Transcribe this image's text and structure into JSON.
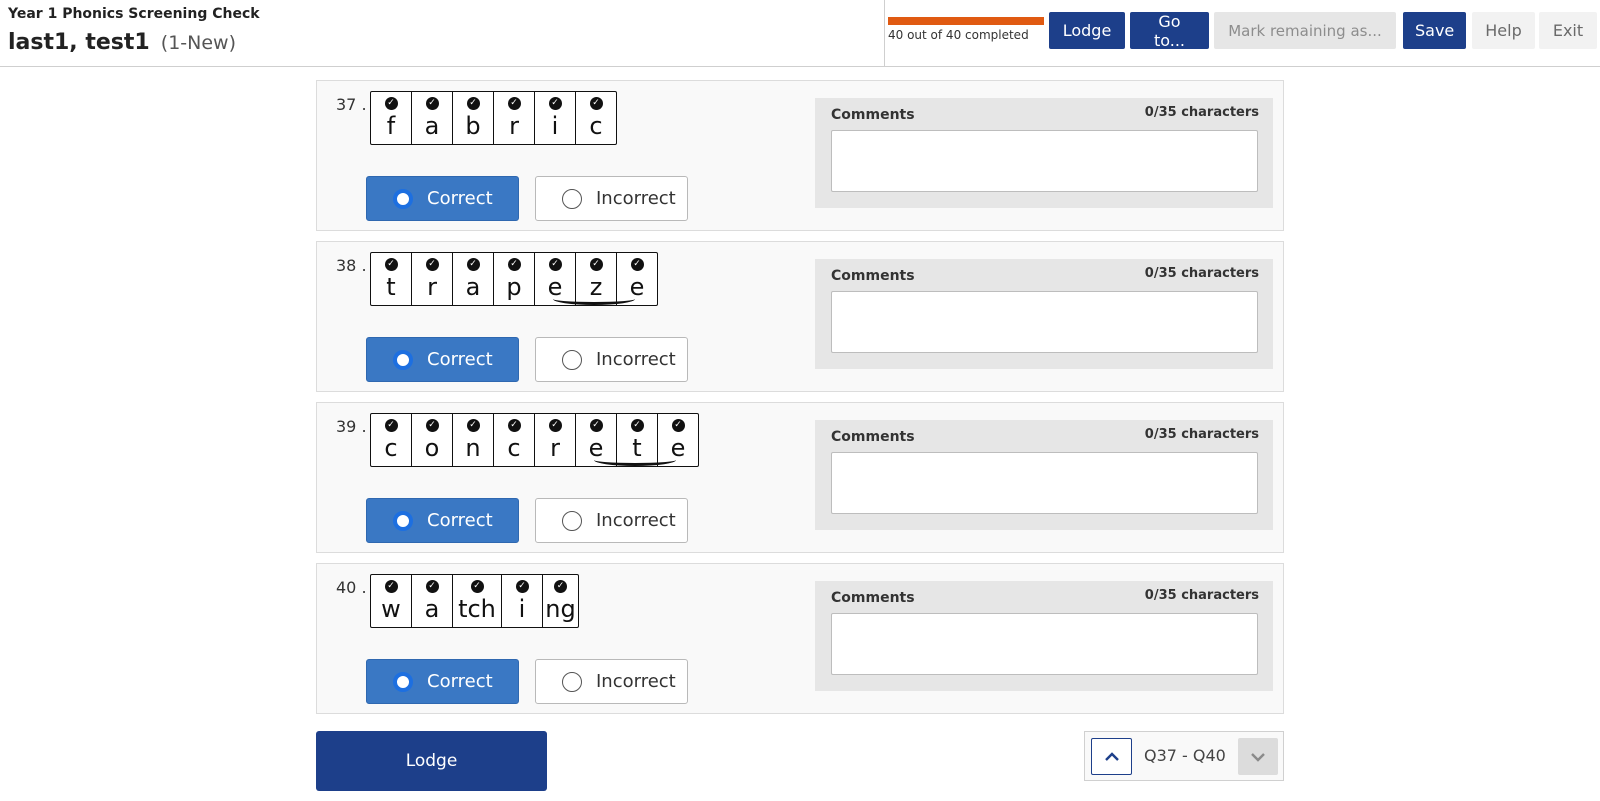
{
  "header": {
    "app_title": "Year 1 Phonics Screening Check",
    "student_name": "last1, test1",
    "student_meta": "(1-New)",
    "progress": {
      "completed": 40,
      "total": 40,
      "fraction": 1.0,
      "text": "40 out of 40 completed",
      "color": "#e05a12"
    },
    "buttons": {
      "lodge": "Lodge",
      "goto": "Go to...",
      "mark_remaining": "Mark remaining as...",
      "save": "Save",
      "help": "Help",
      "exit": "Exit"
    }
  },
  "questions": [
    {
      "number": "37 .",
      "graphemes": [
        "f",
        "a",
        "b",
        "r",
        "i",
        "c"
      ],
      "split_digraph": null,
      "correct_label": "Correct",
      "incorrect_label": "Incorrect",
      "selected": "Correct",
      "comments_label": "Comments",
      "comments_count": "0/35 characters",
      "comments_value": ""
    },
    {
      "number": "38 .",
      "graphemes": [
        "t",
        "r",
        "a",
        "p",
        "e",
        "z",
        "e"
      ],
      "split_digraph": [
        4,
        6
      ],
      "correct_label": "Correct",
      "incorrect_label": "Incorrect",
      "selected": "Correct",
      "comments_label": "Comments",
      "comments_count": "0/35 characters",
      "comments_value": ""
    },
    {
      "number": "39 .",
      "graphemes": [
        "c",
        "o",
        "n",
        "c",
        "r",
        "e",
        "t",
        "e"
      ],
      "split_digraph": [
        5,
        7
      ],
      "correct_label": "Correct",
      "incorrect_label": "Incorrect",
      "selected": "Correct",
      "comments_label": "Comments",
      "comments_count": "0/35 characters",
      "comments_value": ""
    },
    {
      "number": "40 .",
      "graphemes": [
        "w",
        "a",
        "tch",
        "i",
        "ng"
      ],
      "split_digraph": null,
      "correct_label": "Correct",
      "incorrect_label": "Incorrect",
      "selected": "Correct",
      "comments_label": "Comments",
      "comments_count": "0/35 characters",
      "comments_value": ""
    }
  ],
  "footer": {
    "lodge_label": "Lodge",
    "pager_label": "Q37 - Q40",
    "up_icon": "chevron-up-icon",
    "down_icon": "chevron-down-icon"
  },
  "colors": {
    "primary": "#1d3f8a",
    "selected_correct": "#3a78c4",
    "progress": "#e05a12"
  }
}
